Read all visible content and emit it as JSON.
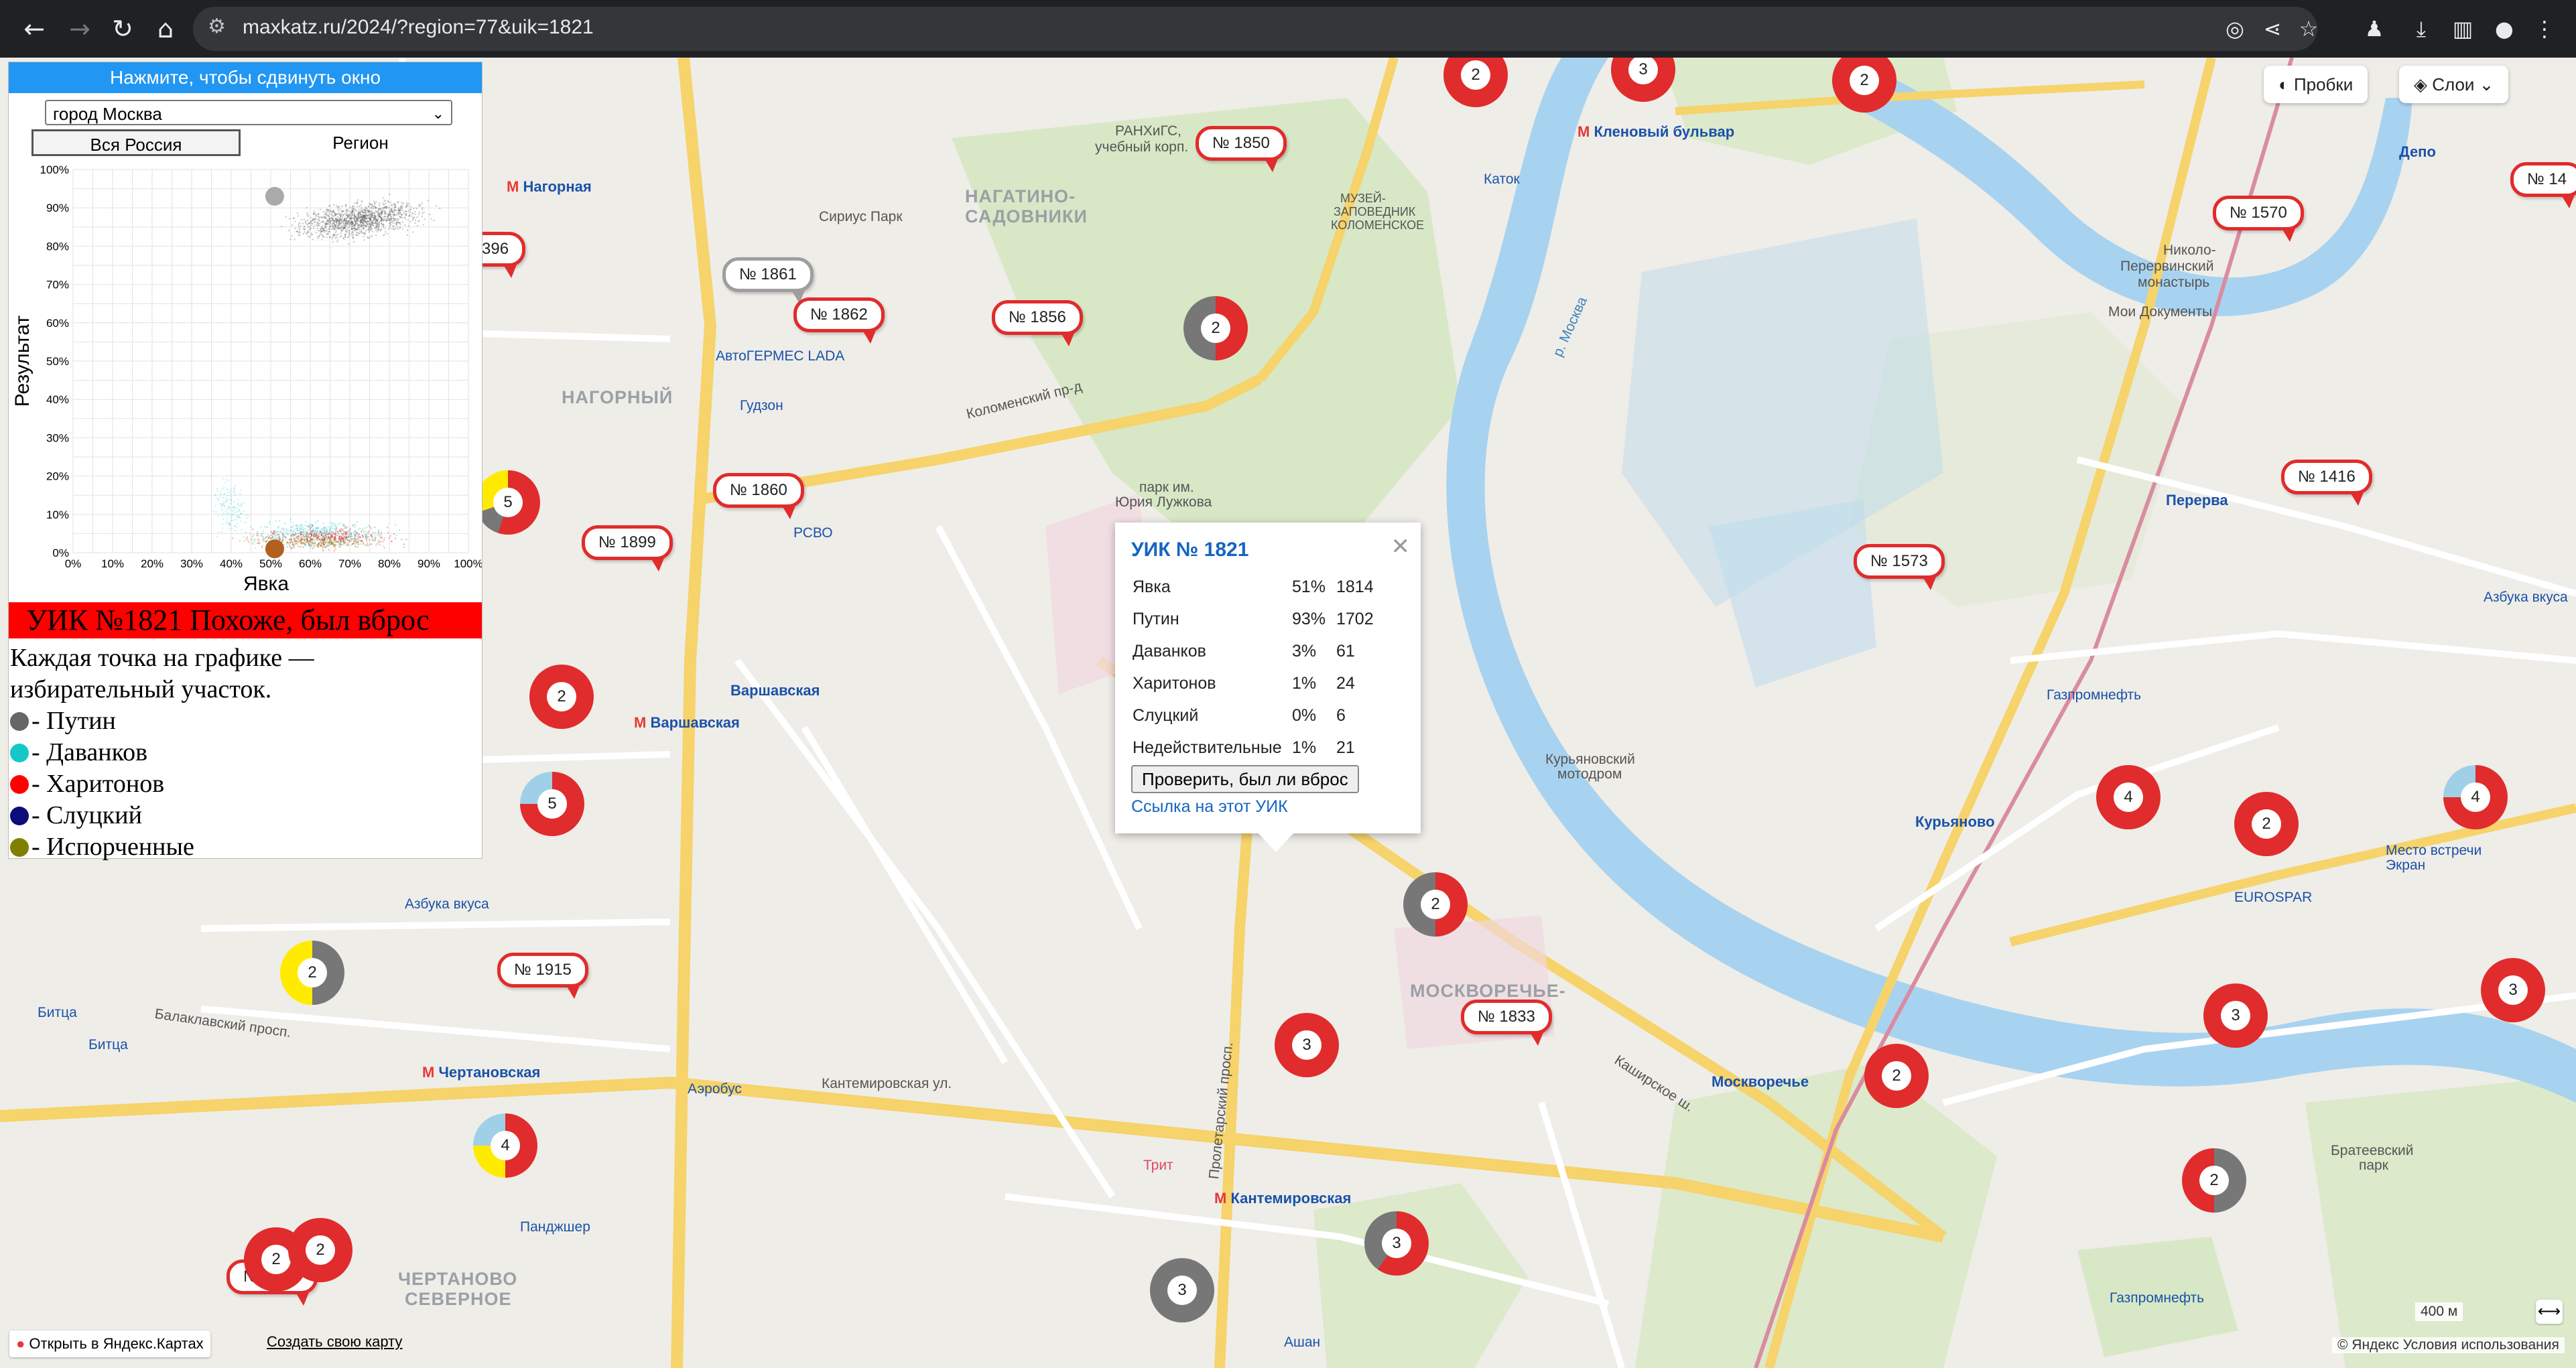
{
  "browser": {
    "url": "maxkatz.ru/2024/?region=77&uik=1821"
  },
  "map_controls": {
    "traffic_label": "Пробки",
    "layers_label": "Слои"
  },
  "panel": {
    "header": "Нажмите, чтобы сдвинуть окно",
    "region_selected": "город Москва",
    "tab_all_russia": "Вся Россия",
    "tab_region": "Регион",
    "verdict": "УИК №1821 Похоже, был вброс",
    "legend_intro": "Каждая точка на графике — избирательный участок.",
    "legend": [
      {
        "label": "- Путин",
        "color": "#666666"
      },
      {
        "label": "- Даванков",
        "color": "#14c8c8"
      },
      {
        "label": "- Харитонов",
        "color": "#ff0000"
      },
      {
        "label": "- Слуцкий",
        "color": "#0c0c7a"
      },
      {
        "label": "- Испорченные",
        "color": "#808000"
      }
    ]
  },
  "chart_data": {
    "type": "scatter",
    "title": "",
    "xlabel": "Явка",
    "ylabel": "Результат",
    "xlim": [
      0,
      100
    ],
    "ylim": [
      0,
      100
    ],
    "x_ticks": [
      "0%",
      "10%",
      "20%",
      "30%",
      "40%",
      "50%",
      "60%",
      "70%",
      "80%",
      "90%",
      "100%"
    ],
    "y_ticks": [
      "0%",
      "10%",
      "20%",
      "30%",
      "40%",
      "50%",
      "60%",
      "70%",
      "80%",
      "90%",
      "100%"
    ],
    "grid": true,
    "highlight": [
      {
        "series": "Путин",
        "x": 51,
        "y": 93,
        "color": "#aaaaaa"
      },
      {
        "series": "Харитонов",
        "x": 51,
        "y": 1,
        "color": "#b06020"
      }
    ]
  },
  "popup": {
    "title": "УИК № 1821",
    "rows": [
      {
        "name": "Явка",
        "pct": "51%",
        "count": "1814"
      },
      {
        "name": "Путин",
        "pct": "93%",
        "count": "1702"
      },
      {
        "name": "Даванков",
        "pct": "3%",
        "count": "61"
      },
      {
        "name": "Харитонов",
        "pct": "1%",
        "count": "24"
      },
      {
        "name": "Слуцкий",
        "pct": "0%",
        "count": "6"
      },
      {
        "name": "Недействительные",
        "pct": "1%",
        "count": "21"
      }
    ],
    "check_button": "Проверить, был ли вброс",
    "link": "Ссылка на этот УИК"
  },
  "uik_tags": [
    "№ 1850",
    "№ 1861",
    "№ 1862",
    "№ 1856",
    "№ 1570",
    "№ 1860",
    "№ 1899",
    "№ 1416",
    "№ 1573",
    "№ 1915",
    "№ 1833",
    "№ 2040",
    "396",
    "№ 14"
  ],
  "clusters": [
    "2",
    "3",
    "2",
    "2",
    "5",
    "2",
    "5",
    "2",
    "2",
    "4",
    "3",
    "3",
    "2",
    "4",
    "2",
    "4",
    "2",
    "3",
    "2",
    "3",
    "3",
    "2"
  ],
  "places": {
    "nagornaya": "Нагорная",
    "nagatino": "НАГАТИНО-",
    "sadovniki": "САДОВНИКИ",
    "nagorny": "НАГОРНЫЙ",
    "varshavskaya_m": "Варшавская",
    "varshavskaya": "Варшавская",
    "chertanovskaya": "Чертановская",
    "kantemirovskaya": "Кантемировская",
    "moskvorechye": "Москворечье",
    "kurianovo": "Курьяново",
    "kurianovo2": "Курьяново",
    "perervo": "Перерва",
    "kleniy": "Кленовый бульвар",
    "depo": "Депо",
    "chertanovo1": "ЧЕРТАНОВО",
    "chertanovo2": "СЕВЕРНОЕ",
    "moskvorechye_d": "МОСКВОРЕЧЬЕ-",
    "kashirskoye": "Каширское ш.",
    "kolomensky": "Коломенский пр-д",
    "balaklavsky": "Балаклавский просп.",
    "kantemirovskaya_ul": "Кантемировская ул.",
    "proletarsky": "Пролетарский просп.",
    "muzei": "МУЗЕЙ-",
    "muzei2": "ЗАПОВЕДНИК",
    "muzei3": "КОЛОМЕНСКОЕ",
    "ranhigs": "РАНХиГС,",
    "ranhigs2": "учебный корп.",
    "sirius": "Сириус Парк",
    "avtogermes": "АвтоГЕРМЕС LADA",
    "gudzon": "Гудзон",
    "park": "парк им.",
    "park2": "Юрия Лужкова",
    "rsvo": "РСВО",
    "moskva": "р. Москва",
    "azbuka": "Азбука вкуса",
    "azbuka2": "Азбука вкуса",
    "kuryanovsky": "Курьяновский",
    "kuryanovsky2": "мотодром",
    "eurospar": "EUROSPAR",
    "gazprom": "Газпромнефть",
    "gazprom2": "Газпромнефть",
    "bratev": "Братеевский",
    "bratev2": "парк",
    "trit": "Трит",
    "aerobus": "Аэробус",
    "pandzhshr": "Панджшер",
    "bitsa": "Битца",
    "bitsa2": "Битца",
    "ashan": "Ашан",
    "katok": "Каток",
    "moi_docs": "Мои Документы",
    "nikolo": "Николо-",
    "nikolo2": "Перервинский",
    "nikolo3": "монастырь",
    "mesto": "Место встречи",
    "mesto2": "Экран",
    "open_ymaps": "Открыть в Яндекс.Картах",
    "create_map": "Создать свою карту",
    "copyright": "© Яндекс Условия использования",
    "scale": "400 м"
  }
}
